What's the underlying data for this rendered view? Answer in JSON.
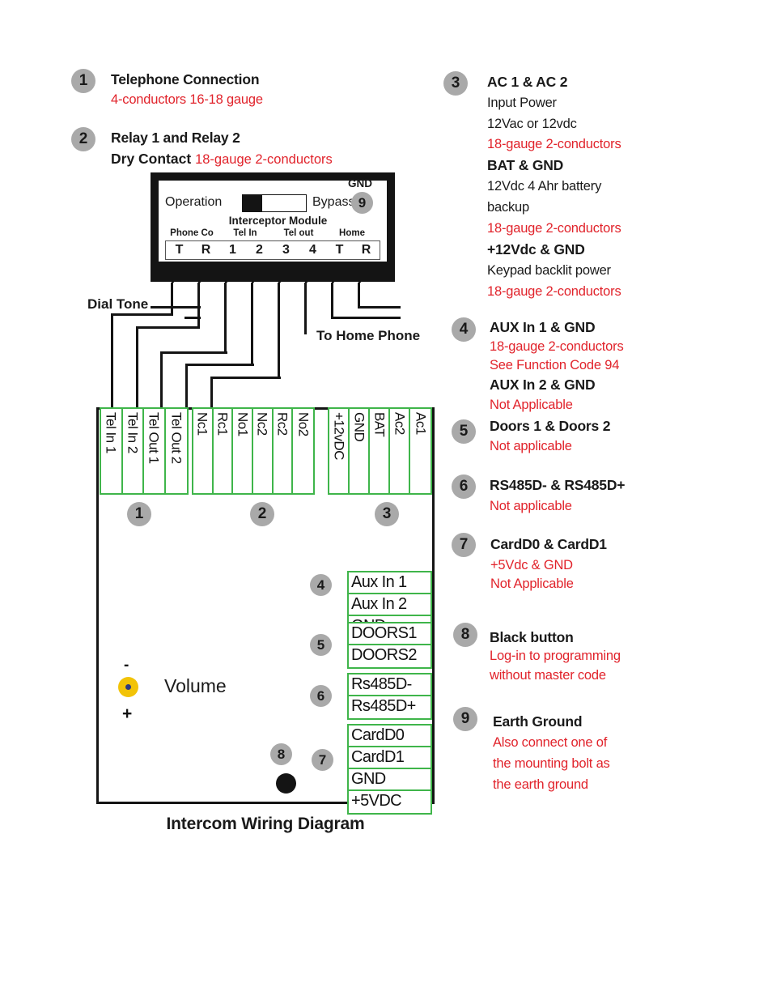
{
  "caption": "Intercom Wiring Diagram",
  "legend_left": [
    {
      "num": "1",
      "title": "Telephone Connection",
      "lines": [
        {
          "text": "4-conductors 16-18 gauge",
          "color": "red"
        }
      ]
    },
    {
      "num": "2",
      "title": "Relay 1 and Relay 2",
      "lines": [
        {
          "text": "Dry Contact",
          "color": "black",
          "bold": true,
          "tail": "18-gauge 2-conductors"
        }
      ]
    }
  ],
  "legend_right": [
    {
      "num": "3",
      "blocks": [
        {
          "heading": "AC 1 & AC 2",
          "lines": [
            {
              "text": "Input Power",
              "color": "black"
            },
            {
              "text": "12Vac or 12vdc",
              "color": "black"
            },
            {
              "text": "18-gauge 2-conductors",
              "color": "red"
            }
          ]
        },
        {
          "heading": "BAT & GND",
          "lines": [
            {
              "text": "12Vdc 4 Ahr battery",
              "color": "black"
            },
            {
              "text": "backup",
              "color": "black"
            },
            {
              "text": "18-gauge 2-conductors",
              "color": "red"
            }
          ]
        },
        {
          "heading": "+12Vdc & GND",
          "lines": [
            {
              "text": "Keypad backlit power",
              "color": "black"
            },
            {
              "text": "18-gauge 2-conductors",
              "color": "red"
            }
          ]
        }
      ]
    },
    {
      "num": "4",
      "blocks": [
        {
          "heading": "AUX In 1 & GND",
          "lines": [
            {
              "text": "18-gauge 2-conductors",
              "color": "red"
            },
            {
              "text": "See Function Code 94",
              "color": "red"
            }
          ]
        },
        {
          "heading": "AUX In 2 & GND",
          "lines": [
            {
              "text": "Not Applicable",
              "color": "red"
            }
          ]
        }
      ]
    },
    {
      "num": "5",
      "blocks": [
        {
          "heading": "Doors 1 & Doors 2",
          "lines": [
            {
              "text": "Not applicable",
              "color": "red"
            }
          ]
        }
      ]
    },
    {
      "num": "6",
      "blocks": [
        {
          "heading": "RS485D- & RS485D+",
          "lines": [
            {
              "text": "Not applicable",
              "color": "red"
            }
          ]
        }
      ]
    },
    {
      "num": "7",
      "blocks": [
        {
          "heading": "CardD0 & CardD1",
          "lines": [
            {
              "text": "+5Vdc & GND",
              "color": "red"
            },
            {
              "text": "Not Applicable",
              "color": "red"
            }
          ]
        }
      ]
    },
    {
      "num": "8",
      "blocks": [
        {
          "heading": "Black button",
          "lines": [
            {
              "text": "Log-in to programming",
              "color": "red"
            },
            {
              "text": "without master code",
              "color": "red"
            }
          ]
        }
      ]
    },
    {
      "num": "9",
      "blocks": [
        {
          "heading": "Earth Ground",
          "lines": [
            {
              "text": "Also connect one of",
              "color": "red"
            },
            {
              "text": "the mounting bolt as",
              "color": "red"
            },
            {
              "text": "the earth ground",
              "color": "red"
            }
          ]
        }
      ]
    }
  ],
  "interceptor": {
    "left_label": "Operation",
    "right_label": "Bypass",
    "module_name": "Interceptor Module",
    "gnd_label": "GND",
    "gnd_badge": "9",
    "groups": [
      "Phone Co",
      "Tel In",
      "Tel out",
      "Home"
    ],
    "terminals": [
      "T",
      "R",
      "1",
      "2",
      "3",
      "4",
      "T",
      "R"
    ]
  },
  "wiring_labels": {
    "dial_tone": "Dial Tone",
    "to_home_phone": "To Home Phone"
  },
  "unit": {
    "group1": {
      "badge": "1",
      "terminals": [
        "Tel In 1",
        "Tel In 2",
        "Tel Out 1",
        "Tel Out 2"
      ]
    },
    "group2": {
      "badge": "2",
      "terminals": [
        "Nc1",
        "Rc1",
        "No1",
        "Nc2",
        "Rc2",
        "No2"
      ]
    },
    "group3": {
      "badge": "3",
      "terminals": [
        "+12vDC",
        "GND",
        "BAT",
        "Ac2",
        "Ac1"
      ]
    },
    "group4": {
      "badge": "4",
      "terminals": [
        "Aux In 1",
        "Aux In 2",
        "GND"
      ]
    },
    "group5": {
      "badge": "5",
      "terminals": [
        "DOORS1",
        "DOORS2"
      ]
    },
    "group6": {
      "badge": "6",
      "terminals": [
        "Rs485D-",
        "Rs485D+"
      ]
    },
    "group7": {
      "badge": "7",
      "terminals": [
        "CardD0",
        "CardD1",
        "GND",
        "+5VDC"
      ]
    },
    "volume_label": "Volume",
    "volume_minus": "-",
    "volume_plus": "+",
    "black_button_badge": "8"
  },
  "colors": {
    "red": "#e1232b",
    "green": "#3fb54a",
    "badge_gray": "#a9a9a9",
    "knob_yellow": "#f2c307",
    "knob_dot": "#2e3a80",
    "black": "#141414"
  }
}
